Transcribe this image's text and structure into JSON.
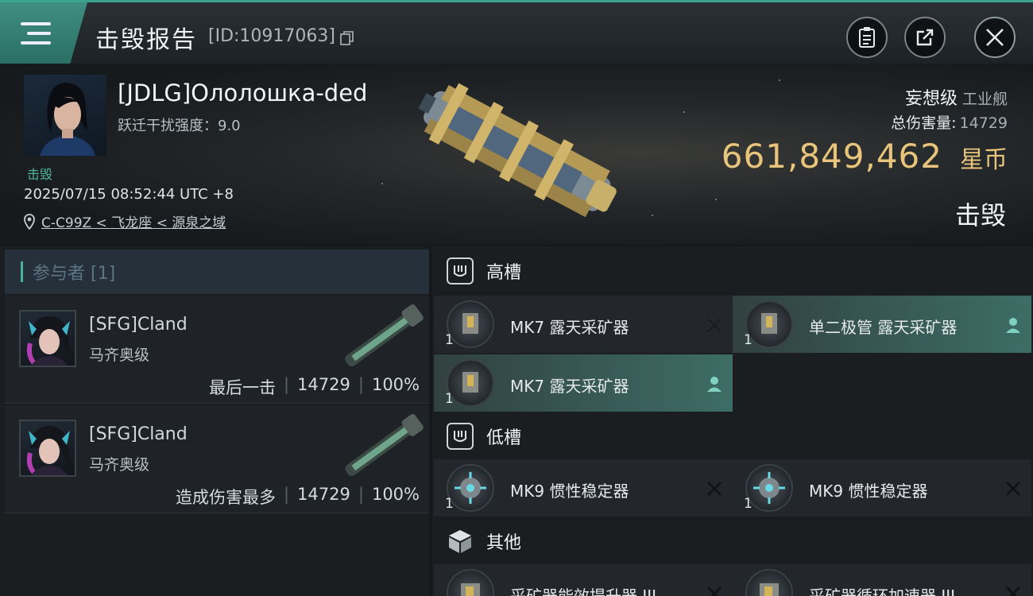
{
  "header": {
    "title": "击毁报告",
    "id_text": "[ID:10917063]"
  },
  "victim": {
    "name": "[JDLG]Ололошка-ded",
    "warp_label": "跃迁干扰强度：9.0",
    "status": "击毁",
    "timestamp": "2025/07/15 08:52:44 UTC +8",
    "location": "C-C99Z < 飞龙座 < 源泉之域",
    "ship_class": "妄想级",
    "ship_type": "工业舰",
    "total_damage_label": "总伤害量:",
    "total_damage": "14729",
    "isk_value": "661,849,462",
    "isk_unit": "星币",
    "result": "击毁"
  },
  "participants": {
    "title": "参与者 [1]",
    "items": [
      {
        "name": "[SFG]Cland",
        "ship": "马齐奥级",
        "role": "最后一击",
        "damage": "14729",
        "percent": "100%"
      },
      {
        "name": "[SFG]Cland",
        "ship": "马齐奥级",
        "role": "造成伤害最多",
        "damage": "14729",
        "percent": "100%"
      }
    ]
  },
  "fitting": {
    "high": {
      "title": "高槽",
      "modules": [
        {
          "name": "MK7 露天采矿器",
          "qty": "1",
          "state": "destroyed"
        },
        {
          "name": "单二极管 露天采矿器",
          "qty": "1",
          "state": "dropped"
        },
        {
          "name": "MK7 露天采矿器",
          "qty": "1",
          "state": "dropped"
        }
      ]
    },
    "low": {
      "title": "低槽",
      "modules": [
        {
          "name": "MK9 惯性稳定器",
          "qty": "1",
          "state": "destroyed"
        },
        {
          "name": "MK9 惯性稳定器",
          "qty": "1",
          "state": "destroyed"
        }
      ]
    },
    "other": {
      "title": "其他",
      "modules": [
        {
          "name": "采矿器能效提升器 III",
          "qty": "1",
          "state": "destroyed"
        },
        {
          "name": "采矿器循环加速器 III",
          "qty": "1",
          "state": "destroyed"
        }
      ]
    }
  },
  "colors": {
    "accent": "#3aa38f",
    "isk": "#e8c57a",
    "active_row": "#3d6d66"
  }
}
